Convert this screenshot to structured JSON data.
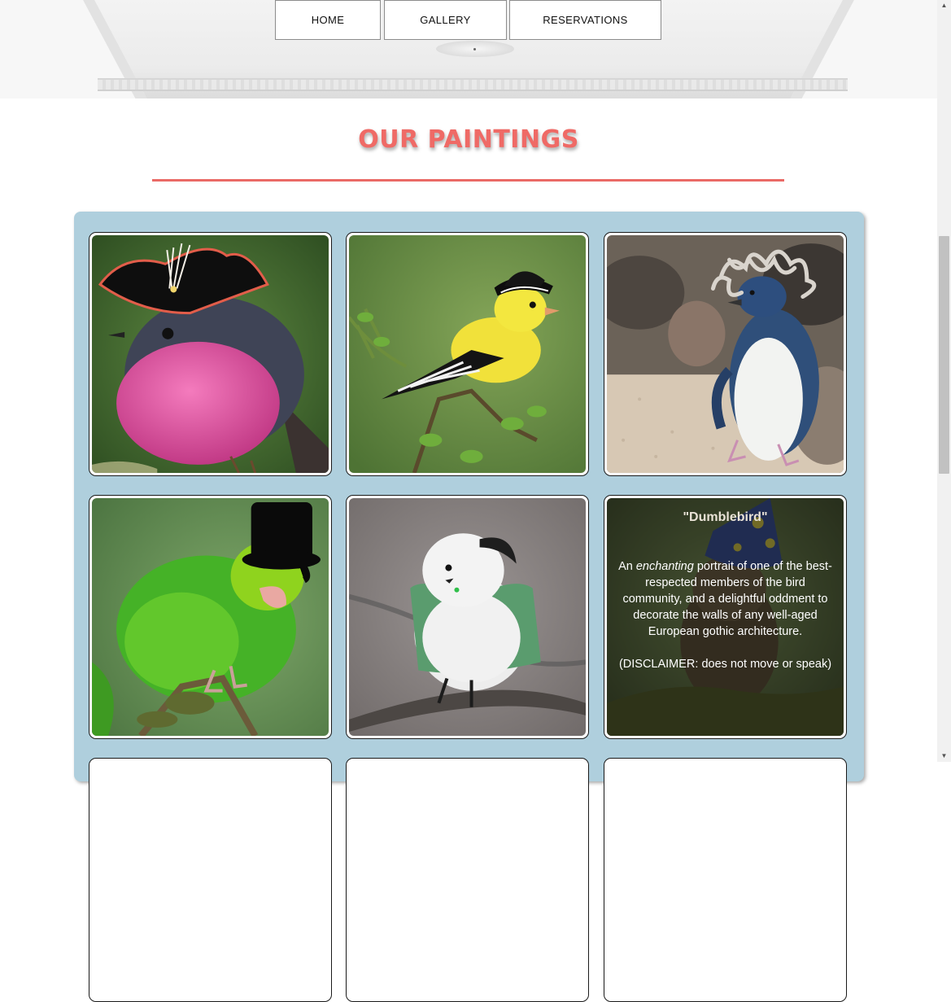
{
  "nav": {
    "items": [
      {
        "label": "HOME"
      },
      {
        "label": "GALLERY"
      },
      {
        "label": "RESERVATIONS"
      }
    ]
  },
  "section": {
    "heading": "OUR PAINTINGS",
    "accent_color": "#ef6a66",
    "panel_color": "#afcfdd"
  },
  "paintings": [
    {
      "subject": "pink robin wearing a pirate tricorn hat with feather",
      "icon": "pirate-robin-painting"
    },
    {
      "subject": "yellow goldfinch wearing a black fedora",
      "icon": "fedora-goldfinch-painting"
    },
    {
      "subject": "little blue penguin wearing a grey mop wig",
      "icon": "wig-penguin-painting"
    },
    {
      "subject": "green parrotlet wearing a black top hat",
      "icon": "tophat-parrotlet-painting"
    },
    {
      "subject": "white long-tailed tit wearing a green cape",
      "icon": "cape-tit-painting"
    },
    {
      "subject": "owl wearing a blue wizard hat with stars",
      "icon": "wizard-owl-painting",
      "title": "\"Dumblebird\"",
      "desc_pre": "An ",
      "desc_em": "enchanting",
      "desc_post": " portrait of one of the best-respected members of the bird community, and a delightful oddment to decorate the walls of any well-aged European gothic architecture.",
      "disclaimer": "(DISCLAIMER: does not move or speak)"
    }
  ]
}
